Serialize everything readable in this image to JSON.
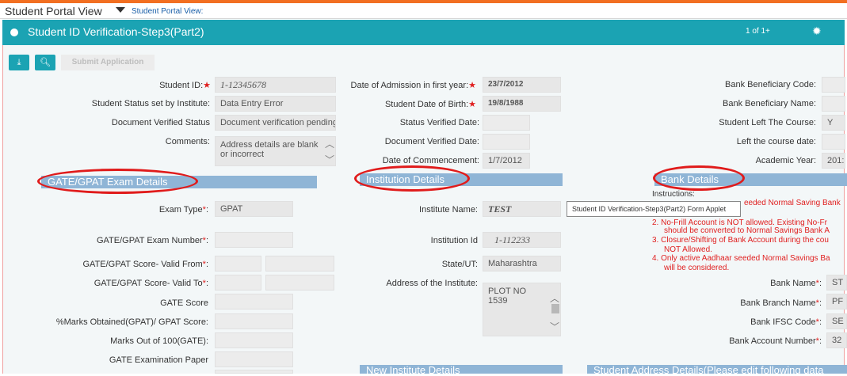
{
  "view": {
    "title": "Student Portal View",
    "link": "Student Portal View:"
  },
  "applet": {
    "title": "Student ID Verification-Step3(Part2)",
    "pager": "1 of 1+"
  },
  "toolbar": {
    "submit_label": "Submit Application"
  },
  "col1": {
    "student_id_label": "Student ID",
    "student_id": "1-12345678",
    "status_label": "Student Status set by Institute:",
    "status": "Data Entry Error",
    "doc_verified_label": "Document Verified Status",
    "doc_verified": "Document verification pending",
    "comments_label": "Comments:",
    "comments": "Address details are blank\nor incorrect"
  },
  "col2": {
    "admission_label": "Date of Admission in first year",
    "admission": "23/7/2012",
    "dob_label": "Student Date of Birth:",
    "dob": "19/8/1988",
    "status_verified_label": "Status Verified Date:",
    "doc_verified_date_label": "Document Verified Date:",
    "commencement_label": "Date of Commencement:",
    "commencement": "1/7/2012"
  },
  "col3": {
    "beneficiary_code_label": "Bank Beneficiary Code:",
    "beneficiary_name_label": "Bank Beneficiary Name:",
    "left_course_label": "Student Left The Course:",
    "left_course": "Y",
    "left_date_label": "Left the course date:",
    "academic_year_label": "Academic Year:",
    "academic_year": "201:"
  },
  "gate": {
    "section_title": "GATE/GPAT Exam Details",
    "exam_type_label": "Exam Type",
    "exam_type": "GPAT",
    "exam_number_label": "GATE/GPAT Exam Number",
    "valid_from_label": "GATE/GPAT Score- Valid From",
    "valid_to_label": "GATE/GPAT Score- Valid To",
    "score_label": "GATE Score",
    "marks_label": "%Marks Obtained(GPAT)/ GPAT Score:",
    "marks100_label": "Marks Out of 100(GATE):",
    "paper_label": "GATE Examination Paper"
  },
  "institution": {
    "section_title": "Institution Details",
    "name_label": "Institute Name:",
    "name": "TEST",
    "id_label": "Institution Id",
    "id": "1-112233",
    "state_label": "State/UT:",
    "state": "Maharashtra",
    "address_label": "Address of the Institute:",
    "address": "PLOT NO\n1539",
    "new_section": "New Institute Details"
  },
  "bank": {
    "section_title": "Bank Details",
    "instructions_label": "Instructions:",
    "instr1": "eeded Normal Saving Bank",
    "instr2a": "2. No-Frill Account is NOT allowed. Existing No-Fr",
    "instr2b": "should be converted to Normal Savings Bank A",
    "instr3a": "3. Closure/Shifting of Bank Account during the cou",
    "instr3b": "NOT Allowed.",
    "instr4a": "4. Only active Aadhaar seeded Normal Savings Ba",
    "instr4b": "will be considered.",
    "name_label": "Bank Name",
    "name": "ST",
    "branch_label": "Bank Branch Name",
    "branch": "PF",
    "ifsc_label": "Bank IFSC Code",
    "ifsc": "SE",
    "account_label": "Bank Account Number",
    "account": "32"
  },
  "student_address": {
    "section_title": "Student Address Details(Please edit following data"
  },
  "tooltip": "Student ID Verification-Step3(Part2) Form Applet",
  "colors": {
    "teal": "#1ba3b3",
    "orange": "#f26f21",
    "section": "#8fb5d6",
    "annotation": "#e01b1b"
  }
}
